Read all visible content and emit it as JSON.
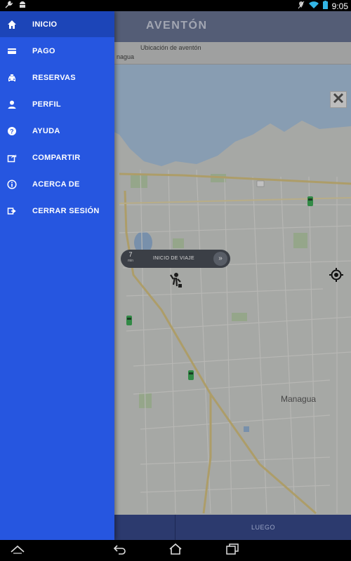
{
  "status_bar": {
    "time": "9:05",
    "left_icons": [
      "wrench-icon",
      "android-icon"
    ],
    "right_icons": [
      "location-off-icon",
      "wifi-icon",
      "battery-icon"
    ]
  },
  "app": {
    "title": "AVENTÓN",
    "address": {
      "label": "Ubicación de aventón",
      "value": "nagua"
    }
  },
  "map": {
    "city_label": "Managua",
    "trip_button": {
      "eta_value": "7",
      "eta_unit": "min",
      "label": "INICIO DE VIAJE",
      "go_glyph": "»"
    }
  },
  "bottom_bar": {
    "luego_label": "LUEGO"
  },
  "drawer": {
    "items": [
      {
        "label": "INICIO",
        "icon": "home-icon",
        "active": true
      },
      {
        "label": "PAGO",
        "icon": "credit-card-icon",
        "active": false
      },
      {
        "label": "RESERVAS",
        "icon": "taxi-icon",
        "active": false
      },
      {
        "label": "PERFIL",
        "icon": "person-icon",
        "active": false
      },
      {
        "label": "AYUDA",
        "icon": "help-icon",
        "active": false
      },
      {
        "label": "COMPARTIR",
        "icon": "share-icon",
        "active": false
      },
      {
        "label": "ACERCA DE",
        "icon": "info-icon",
        "active": false
      },
      {
        "label": "CERRAR SESIÓN",
        "icon": "logout-icon",
        "active": false
      }
    ]
  },
  "colors": {
    "drawer_bg": "#2656e0",
    "drawer_active": "#1c45b8",
    "header_bg": "#5e6a8c",
    "car_marker": "#2ea84a"
  }
}
